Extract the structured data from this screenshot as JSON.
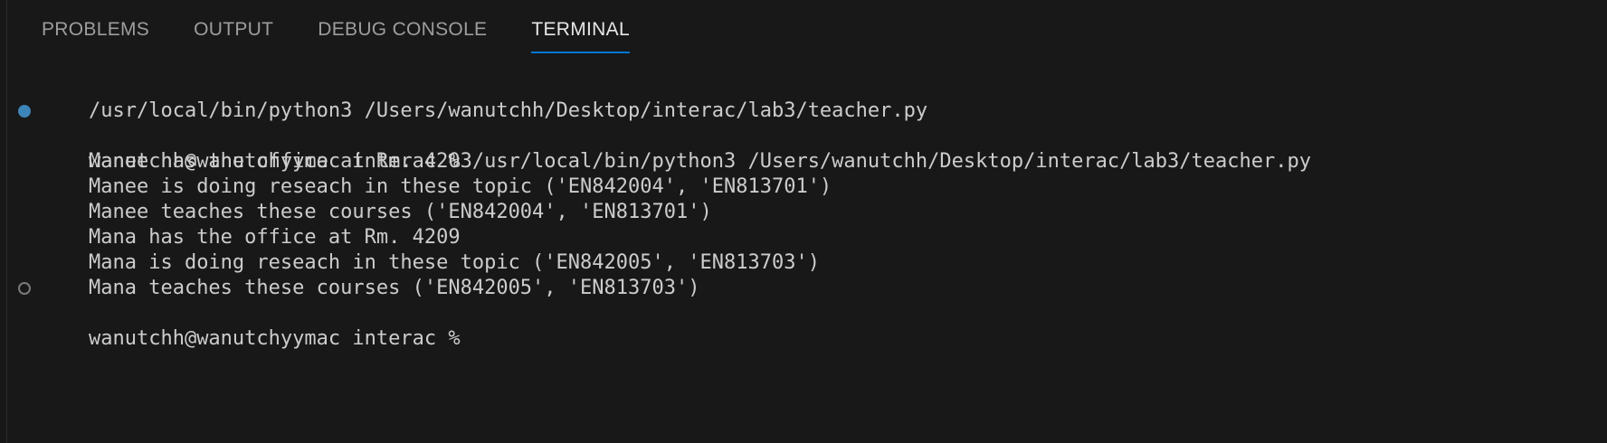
{
  "panel": {
    "tabs": [
      {
        "label": "PROBLEMS",
        "active": false
      },
      {
        "label": "OUTPUT",
        "active": false
      },
      {
        "label": "DEBUG CONSOLE",
        "active": false
      },
      {
        "label": "TERMINAL",
        "active": true
      }
    ]
  },
  "terminal": {
    "lines": [
      "/usr/local/bin/python3 /Users/wanutchh/Desktop/interac/lab3/teacher.py",
      "wanutchh@wanutchyymac interac % /usr/local/bin/python3 /Users/wanutchh/Desktop/interac/lab3/teacher.py",
      "Manee has the office at Rm. 4203",
      "Manee is doing reseach in these topic ('EN842004', 'EN813701')",
      "Manee teaches these courses ('EN842004', 'EN813701')",
      "Mana has the office at Rm. 4209",
      "Mana is doing reseach in these topic ('EN842005', 'EN813703')",
      "Mana teaches these courses ('EN842005', 'EN813703')",
      "wanutchh@wanutchyymac interac % "
    ]
  },
  "colors": {
    "background": "#181818",
    "active_tab_underline": "#0078d4",
    "command_marker": "#3d84b8",
    "text": "#cccccc"
  }
}
